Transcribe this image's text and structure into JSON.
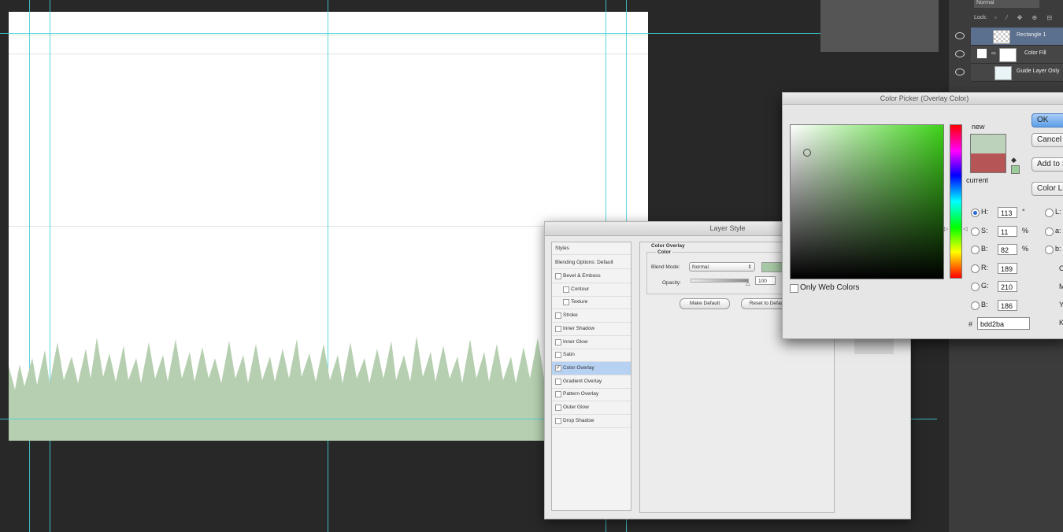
{
  "layers_panel": {
    "lock_label": "Lock:",
    "blend_dropdown": "Normal",
    "layers": [
      {
        "name": "Rectangle 1",
        "selected": true
      },
      {
        "name": "Color Fill",
        "selected": false
      },
      {
        "name": "Guide Layer Only",
        "selected": false
      }
    ]
  },
  "layer_style": {
    "title": "Layer Style",
    "styles_header": "Styles",
    "blending_options": "Blending Options: Default",
    "items": [
      {
        "label": "Bevel & Emboss",
        "checked": false
      },
      {
        "label": "Contour",
        "checked": false
      },
      {
        "label": "Texture",
        "checked": false
      },
      {
        "label": "Stroke",
        "checked": false
      },
      {
        "label": "Inner Shadow",
        "checked": false
      },
      {
        "label": "Inner Glow",
        "checked": false
      },
      {
        "label": "Satin",
        "checked": false
      },
      {
        "label": "Color Overlay",
        "checked": true
      },
      {
        "label": "Gradient Overlay",
        "checked": false
      },
      {
        "label": "Pattern Overlay",
        "checked": false
      },
      {
        "label": "Outer Glow",
        "checked": false
      },
      {
        "label": "Drop Shadow",
        "checked": false
      }
    ],
    "section_title": "Color Overlay",
    "group_title": "Color",
    "blend_mode_label": "Blend Mode:",
    "blend_mode_value": "Normal",
    "opacity_label": "Opacity:",
    "opacity_value": "100",
    "make_default": "Make Default",
    "reset_default": "Reset to Default",
    "swatch_color": "#a8c9a6"
  },
  "color_picker": {
    "title": "Color Picker (Overlay Color)",
    "new_label": "new",
    "current_label": "current",
    "new_color": "#bdd2ba",
    "current_color": "#b55556",
    "buttons": {
      "ok": "OK",
      "cancel": "Cancel",
      "add_to_swatches": "Add to Swatches",
      "color_libraries": "Color Libraries"
    },
    "only_web_colors": "Only Web Colors",
    "fields": [
      {
        "label": "H:",
        "value": "113",
        "unit": "°",
        "selected": true
      },
      {
        "label": "S:",
        "value": "11",
        "unit": "%",
        "selected": false
      },
      {
        "label": "B:",
        "value": "82",
        "unit": "%",
        "selected": false
      },
      {
        "label": "R:",
        "value": "189",
        "unit": "",
        "selected": false
      },
      {
        "label": "G:",
        "value": "210",
        "unit": "",
        "selected": false
      },
      {
        "label": "B:",
        "value": "186",
        "unit": "",
        "selected": false
      }
    ],
    "lab_labels": [
      "L:",
      "a:",
      "b:"
    ],
    "cmyk_labels": [
      "C",
      "M",
      "Y",
      "K"
    ],
    "hex_label": "#",
    "hex_value": "bdd2ba"
  },
  "colors": {
    "grass": "#b5cfb0",
    "guide": "#3fd1d8",
    "workspace": "#282828"
  }
}
